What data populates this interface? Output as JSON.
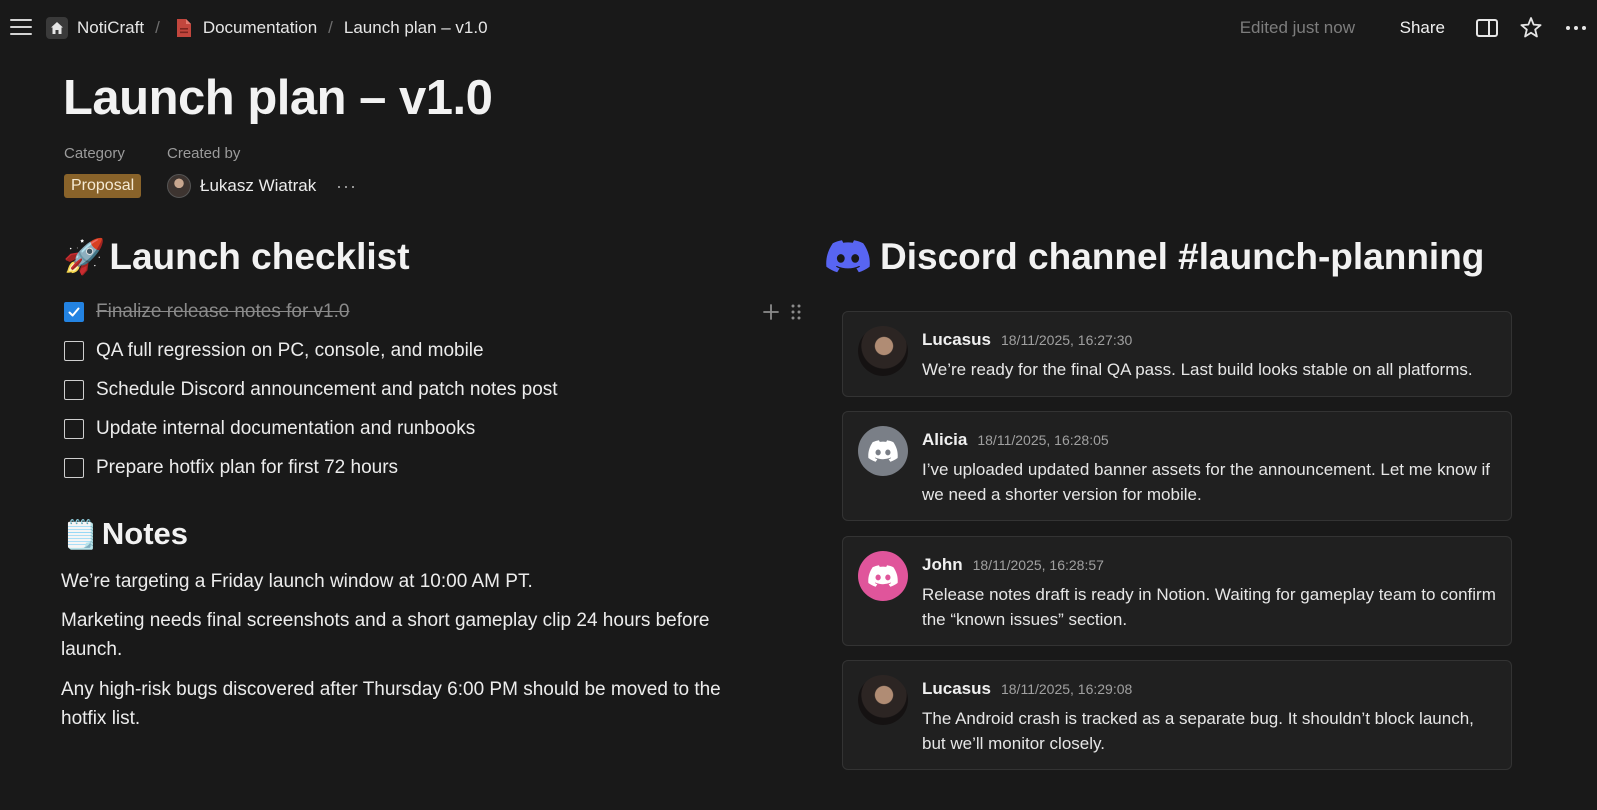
{
  "topbar": {
    "workspace": "NotiCraft",
    "breadcrumb_parent": "Documentation",
    "breadcrumb_current": "Launch plan – v1.0",
    "edited_status": "Edited just now",
    "share_label": "Share"
  },
  "page": {
    "title": "Launch plan – v1.0",
    "properties": {
      "category_label": "Category",
      "category_value": "Proposal",
      "created_by_label": "Created by",
      "created_by_value": "Łukasz Wiatrak"
    }
  },
  "checklist": {
    "heading_emoji": "🚀",
    "heading": "Launch checklist",
    "items": [
      {
        "label": "Finalize release notes for v1.0",
        "checked": true
      },
      {
        "label": "QA full regression on PC, console, and mobile",
        "checked": false
      },
      {
        "label": "Schedule Discord announcement and patch notes post",
        "checked": false
      },
      {
        "label": "Update internal documentation and runbooks",
        "checked": false
      },
      {
        "label": "Prepare hotfix plan for first 72 hours",
        "checked": false
      }
    ]
  },
  "notes": {
    "heading_emoji": "🗒️",
    "heading": "Notes",
    "paragraphs": [
      "We’re targeting a Friday launch window at 10:00 AM PT.",
      "Marketing needs final screenshots and a short gameplay clip 24 hours before launch.",
      "Any high-risk bugs discovered after Thursday 6:00 PM should be moved to the hotfix list."
    ]
  },
  "discord": {
    "heading": "Discord channel #launch-planning",
    "brand_color": "#5865F2",
    "messages": [
      {
        "author": "Lucasus",
        "time": "18/11/2025, 16:27:30",
        "text": "We’re ready for the final QA pass. Last build looks stable on all platforms.",
        "avatar": "photo"
      },
      {
        "author": "Alicia",
        "time": "18/11/2025, 16:28:05",
        "text": "I’ve uploaded updated banner assets for the announcement. Let me know if we need a shorter version for mobile.",
        "avatar": "discord-gray"
      },
      {
        "author": "John",
        "time": "18/11/2025, 16:28:57",
        "text": "Release notes draft is ready in Notion. Waiting for gameplay team to confirm the “known issues” section.",
        "avatar": "discord-pink"
      },
      {
        "author": "Lucasus",
        "time": "18/11/2025, 16:29:08",
        "text": "The Android crash is tracked as a separate bug. It shouldn’t block launch, but we’ll monitor closely.",
        "avatar": "photo"
      }
    ]
  },
  "icons": [
    "menu-icon",
    "home-icon",
    "document-icon",
    "sidebar-panel-icon",
    "star-icon",
    "more-icon",
    "plus-icon",
    "drag-handle-icon",
    "discord-logo-icon",
    "check-icon"
  ]
}
